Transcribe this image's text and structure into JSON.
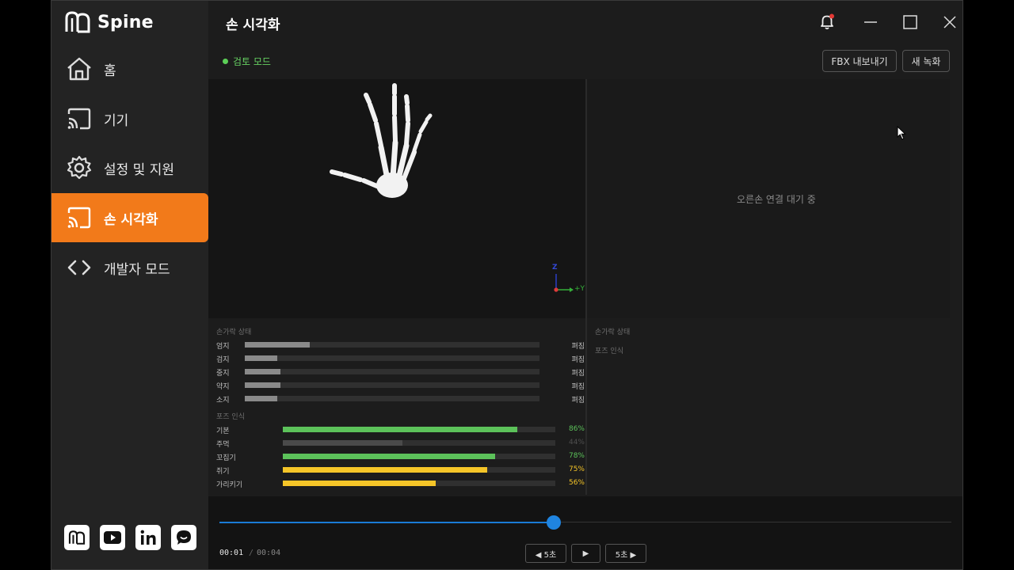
{
  "app": {
    "name": "Spine"
  },
  "header": {
    "title": "손 시각화"
  },
  "sidebar": {
    "items": [
      {
        "label": "홈",
        "icon": "home-icon"
      },
      {
        "label": "기기",
        "icon": "cast-icon"
      },
      {
        "label": "설정 및 지원",
        "icon": "gear-icon"
      },
      {
        "label": "손 시각화",
        "icon": "cast-icon",
        "active": true
      },
      {
        "label": "개발자 모드",
        "icon": "code-icon"
      }
    ],
    "social": [
      "spine-logo-icon",
      "youtube-icon",
      "linkedin-icon",
      "chat-icon"
    ]
  },
  "toolbar": {
    "mode_label": "검토 모드",
    "export_label": "FBX 내보내기",
    "record_label": "새 녹화"
  },
  "viewport": {
    "axis_y_label": "+Y",
    "axis_z_label": "Z"
  },
  "right_panel": {
    "waiting_text": "오른손 연결 대기 중",
    "finger_title": "손가락 상태",
    "pose_title": "포즈 인식"
  },
  "left_stats": {
    "finger_title": "손가락 상태",
    "fingers": [
      {
        "label": "엄지",
        "value": 0.22,
        "status": "펴짐"
      },
      {
        "label": "검지",
        "value": 0.11,
        "status": "펴짐"
      },
      {
        "label": "중지",
        "value": 0.12,
        "status": "펴짐"
      },
      {
        "label": "약지",
        "value": 0.12,
        "status": "펴짐"
      },
      {
        "label": "소지",
        "value": 0.11,
        "status": "펴짐"
      }
    ],
    "pose_title": "포즈 인식",
    "poses": [
      {
        "label": "기본",
        "percent": 86,
        "text": "86%",
        "color": "#5cc25a"
      },
      {
        "label": "주먹",
        "percent": 44,
        "text": "44%",
        "color": "#4a4a4a"
      },
      {
        "label": "꼬집기",
        "percent": 78,
        "text": "78%",
        "color": "#5cc25a"
      },
      {
        "label": "쥐기",
        "percent": 75,
        "text": "75%",
        "color": "#f5c528"
      },
      {
        "label": "가리키기",
        "percent": 56,
        "text": "56%",
        "color": "#f5c528"
      }
    ]
  },
  "playback": {
    "current": "00:01",
    "separator": "/",
    "total": "00:04",
    "progress": 0.457,
    "back_label": "◀ 5초",
    "play_label": "▶",
    "forward_label": "5초 ▶"
  },
  "colors": {
    "accent": "#f27a1a",
    "mode_green": "#5ccf57",
    "slider_blue": "#1f84e0"
  }
}
